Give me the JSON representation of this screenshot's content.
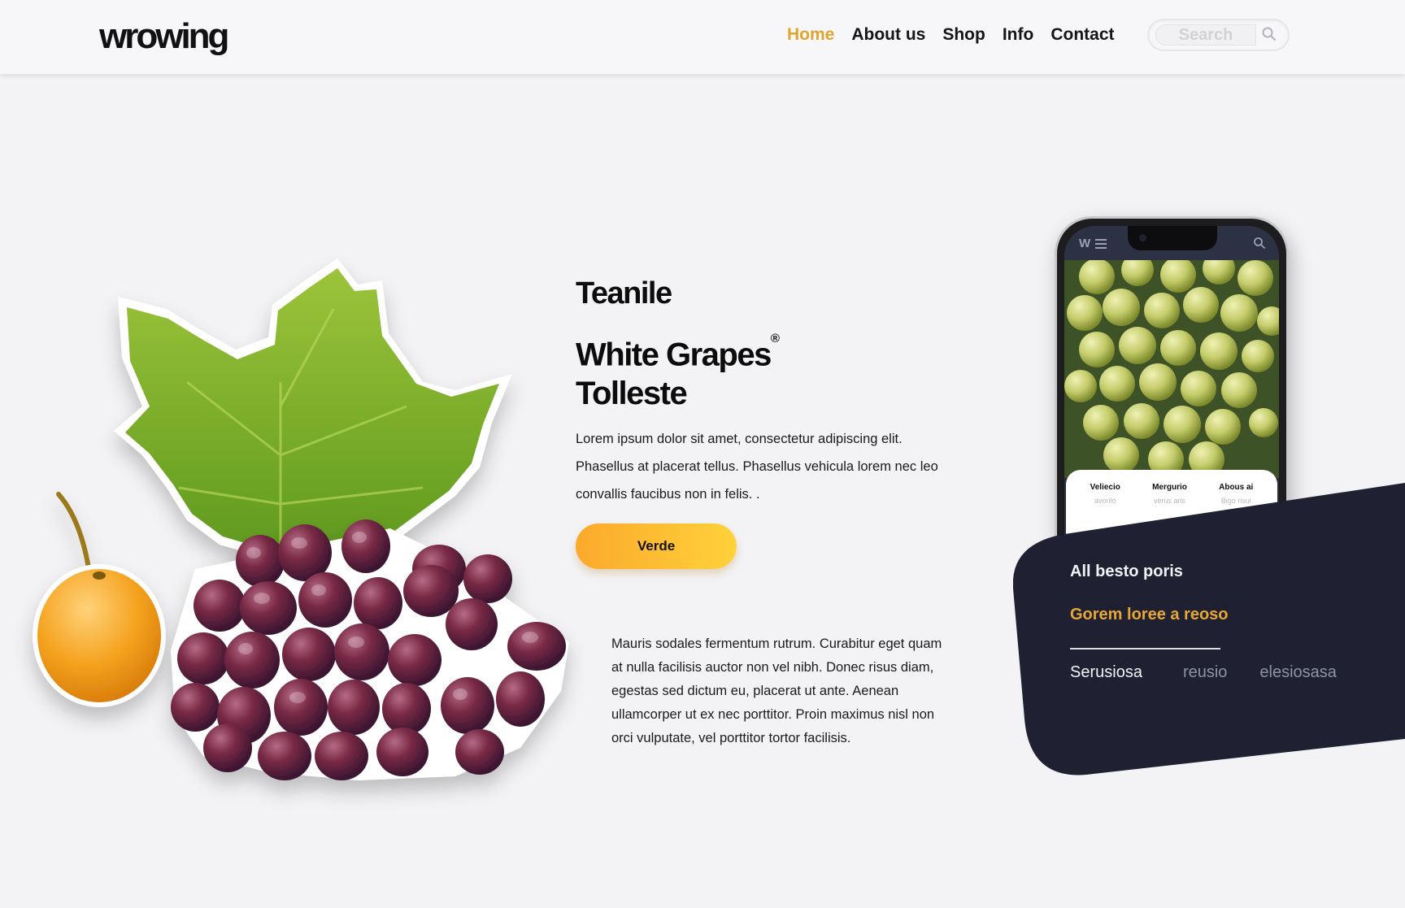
{
  "brand": {
    "logo_text": "wrowing"
  },
  "nav": {
    "items": [
      {
        "label": "Home",
        "active": true
      },
      {
        "label": "About us",
        "active": false
      },
      {
        "label": "Shop",
        "active": false
      },
      {
        "label": "Info",
        "active": false
      },
      {
        "label": "Contact",
        "active": false
      }
    ]
  },
  "search": {
    "placeholder": "Search",
    "icon": "search-icon"
  },
  "hero": {
    "eyebrow": "Teanile",
    "title_line1": "White Grapes",
    "title_mark": "®",
    "title_line2": "Tolleste",
    "intro": "Lorem ipsum dolor sit amet, consectetur adipiscing elit. Phasellus at placerat tellus. Phasellus vehicula lorem nec leo convallis faucibus non in felis. .",
    "cta_label": "Verde",
    "body": "Mauris sodales fermentum rutrum. Curabitur eget quam at nulla facilisis auctor non vel nibh. Donec risus diam, egestas sed dictum eu, placerat ut ante. Aenean ullamcorper ut ex nec porttitor. Proin maximus nisl non orci vulputate, vel porttitor tortor facilisis."
  },
  "phone": {
    "logo": "W",
    "tabs": [
      {
        "title": "Veliecio",
        "sub": "avorilo"
      },
      {
        "title": "Mergurio",
        "sub": "verus aris"
      },
      {
        "title": "Abous ai",
        "sub": "Bigo risui"
      }
    ]
  },
  "card": {
    "title": "All besto poris",
    "subtitle": "Gorem loree a reoso",
    "links": [
      {
        "label": "Serusiosa",
        "active": true
      },
      {
        "label": "reusio",
        "active": false
      },
      {
        "label": "elesiosasa",
        "active": false
      }
    ]
  },
  "colors": {
    "accent": "#e0a52d",
    "dark_card": "#1f2133",
    "cta_start": "#fba92c",
    "cta_end": "#ffd23a"
  }
}
